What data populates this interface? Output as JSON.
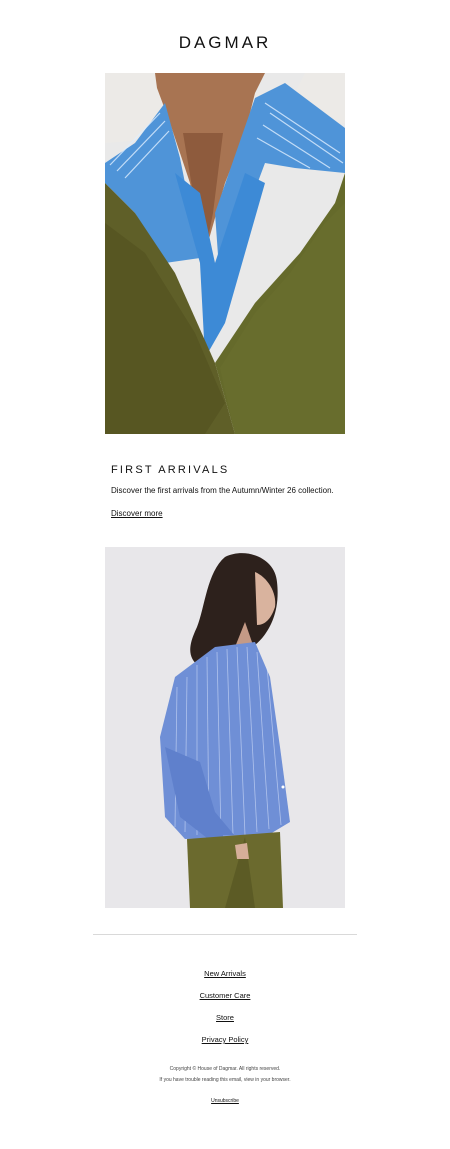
{
  "brand": {
    "logo": "DAGMAR"
  },
  "hero": {
    "image": "model-olive-blazer-striped-shirt-photo"
  },
  "feature": {
    "heading": "FIRST ARRIVALS",
    "text": "Discover the first arrivals from the Autumn/Winter 26 collection.",
    "cta": "Discover more"
  },
  "secondary": {
    "image": "model-cropped-striped-shirt-photo"
  },
  "footer": {
    "links": [
      "New Arrivals",
      "Customer Care",
      "Store",
      "Privacy Policy"
    ],
    "copyright": "Copyright © House of Dagmar. All rights reserved.",
    "trouble": "If you have trouble reading this email, view in your browser.",
    "unsubscribe": "Unsubscribe"
  },
  "colors": {
    "olive": "#5f5f28",
    "shirt_blue": "#4f94d8",
    "stripe_blue": "#6f8fd6",
    "background": "#ffffff"
  }
}
